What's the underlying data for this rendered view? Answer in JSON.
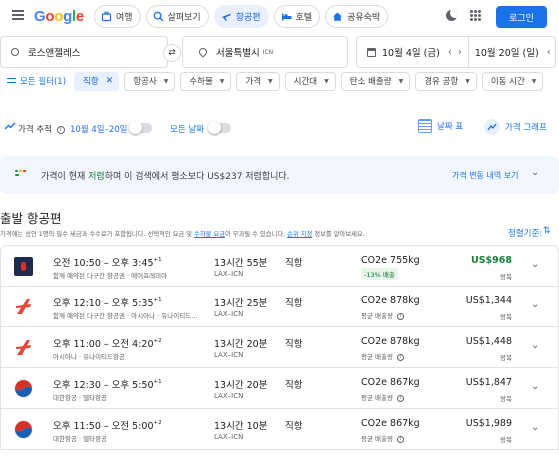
{
  "header": {
    "logo_text": "Google",
    "nav_tabs": [
      {
        "label": "여행",
        "icon": "travel-icon"
      },
      {
        "label": "살펴보기",
        "icon": "explore-icon"
      },
      {
        "label": "항공편",
        "icon": "flight-icon",
        "active": true
      },
      {
        "label": "호텔",
        "icon": "hotel-icon"
      },
      {
        "label": "공유숙박",
        "icon": "house-icon"
      }
    ],
    "login_label": "로그인"
  },
  "search": {
    "origin": "로스앤젤레스",
    "destination": "서울특별시",
    "destination_code": "ICN",
    "depart_date": "10월 4일 (금)",
    "return_date": "10월 20일 (일)"
  },
  "filters": {
    "all_filters_label": "모든 필터(1)",
    "chips": [
      {
        "label": "직항",
        "selected": true
      },
      {
        "label": "항공사"
      },
      {
        "label": "수하물"
      },
      {
        "label": "가격"
      },
      {
        "label": "시간대"
      },
      {
        "label": "탄소 배출량"
      },
      {
        "label": "경유 공항"
      },
      {
        "label": "이동 시간"
      }
    ]
  },
  "tracking": {
    "label": "가격 추적",
    "dates": "10월 4일–20일",
    "all_dates_label": "모든 날짜",
    "date_table_label": "날짜 표",
    "price_graph_label": "가격 그래프"
  },
  "insight": {
    "prefix": "가격이 현재 ",
    "highlight": "저렴",
    "suffix": "하며 이 검색에서 평소보다 US$237 저렴합니다.",
    "history_label": "가격 변동 내역 보기"
  },
  "section": {
    "title": "출발 항공편",
    "subtitle_a": "가격에는 성인 1명의 필수 세금과 수수료가 포함됩니다. 선택적인 요금 및 ",
    "subtitle_link1": "수하물 요금",
    "subtitle_b": "이 부과될 수 있습니다. ",
    "subtitle_link2": "순위 지정",
    "subtitle_c": " 정보를 알아보세요.",
    "sort_label": "정렬기준:"
  },
  "flights": [
    {
      "time": "오전 10:50 – 오후 3:45",
      "plus": "+1",
      "airline": "함께 예약된 다구간 항공권 · 에어프레미아",
      "duration": "13시간 55분",
      "route": "LAX–ICN",
      "stops": "직항",
      "co2": "CO2e 755kg",
      "co2_note": "-13% 배출",
      "co2_badge": true,
      "price": "US$968",
      "price_type": "왕복",
      "logo": "air-premia",
      "cheap": true
    },
    {
      "time": "오후 12:10 – 오후 5:35",
      "plus": "+1",
      "airline": "함께 예약된 다구간 항공권 · 아시아나 · 유나이티드...",
      "duration": "13시간 25분",
      "route": "LAX–ICN",
      "stops": "직항",
      "co2": "CO2e 878kg",
      "co2_note": "평균 배출량",
      "price": "US$1,344",
      "price_type": "왕복",
      "logo": "asiana"
    },
    {
      "time": "오후 11:00 – 오전 4:20",
      "plus": "+2",
      "airline": "아시아나 · 유나이티드항공",
      "duration": "13시간 20분",
      "route": "LAX–ICN",
      "stops": "직항",
      "co2": "CO2e 878kg",
      "co2_note": "평균 배출량",
      "price": "US$1,448",
      "price_type": "왕복",
      "logo": "asiana"
    },
    {
      "time": "오후 12:30 – 오후 5:50",
      "plus": "+1",
      "airline": "대한항공 · 델타항공",
      "duration": "13시간 20분",
      "route": "LAX–ICN",
      "stops": "직항",
      "co2": "CO2e 867kg",
      "co2_note": "평균 배출량",
      "price": "US$1,847",
      "price_type": "왕복",
      "logo": "korean-air"
    },
    {
      "time": "오후 11:50 – 오전 5:00",
      "plus": "+2",
      "airline": "대한항공 · 델타항공",
      "duration": "13시간 10분",
      "route": "LAX–ICN",
      "stops": "직항",
      "co2": "CO2e 867kg",
      "co2_note": "평균 배출량",
      "price": "US$1,989",
      "price_type": "왕복",
      "logo": "korean-air"
    }
  ],
  "colors": {
    "accent": "#1a73e8",
    "green": "#188038",
    "asiana": "#ea4335",
    "korean_air_red": "#d93025",
    "korean_air_blue": "#1a5fb4",
    "air_premia": "#1e2b4f"
  }
}
